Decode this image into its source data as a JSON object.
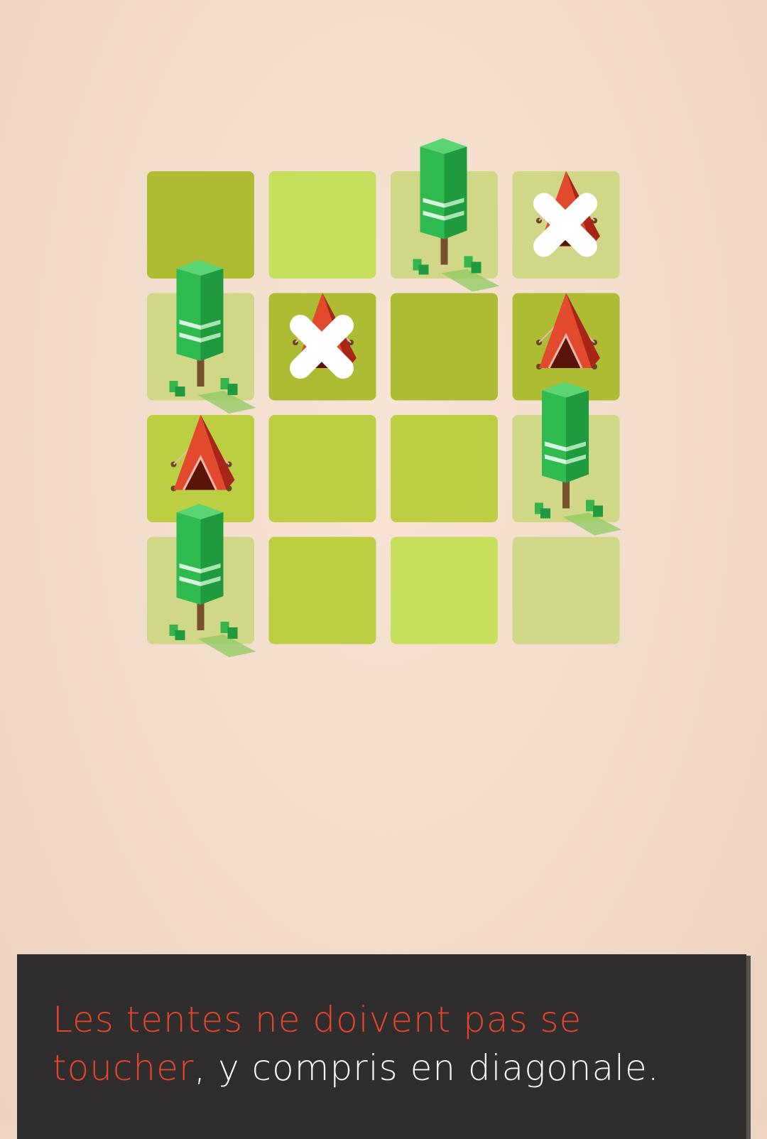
{
  "tutorial": {
    "highlight": "Les tentes ne doivent pas se toucher",
    "rest": ", y compris en diagonale."
  },
  "board": {
    "rows": 4,
    "cols": 4,
    "cells": [
      [
        {
          "shade": "dark",
          "item": null
        },
        {
          "shade": "bright",
          "item": null
        },
        {
          "shade": "pale",
          "item": "tree"
        },
        {
          "shade": "pale",
          "item": "tent-rejected"
        }
      ],
      [
        {
          "shade": "pale",
          "item": "tree"
        },
        {
          "shade": "dark",
          "item": "tent-rejected"
        },
        {
          "shade": "dark",
          "item": null
        },
        {
          "shade": "dark",
          "item": "tent"
        }
      ],
      [
        {
          "shade": "mid",
          "item": "tent"
        },
        {
          "shade": "mid",
          "item": null
        },
        {
          "shade": "mid",
          "item": null
        },
        {
          "shade": "pale",
          "item": "tree"
        }
      ],
      [
        {
          "shade": "pale",
          "item": "tree"
        },
        {
          "shade": "mid",
          "item": null
        },
        {
          "shade": "bright",
          "item": null
        },
        {
          "shade": "pale",
          "item": null
        }
      ]
    ]
  },
  "colors": {
    "dark": "#aebc34",
    "mid": "#bccf42",
    "bright": "#c6df5c",
    "pale": "#d0d887",
    "tent": "#c8321e",
    "tree": "#1fa845",
    "accent": "#e4452a",
    "panel": "#2f2d2d"
  }
}
